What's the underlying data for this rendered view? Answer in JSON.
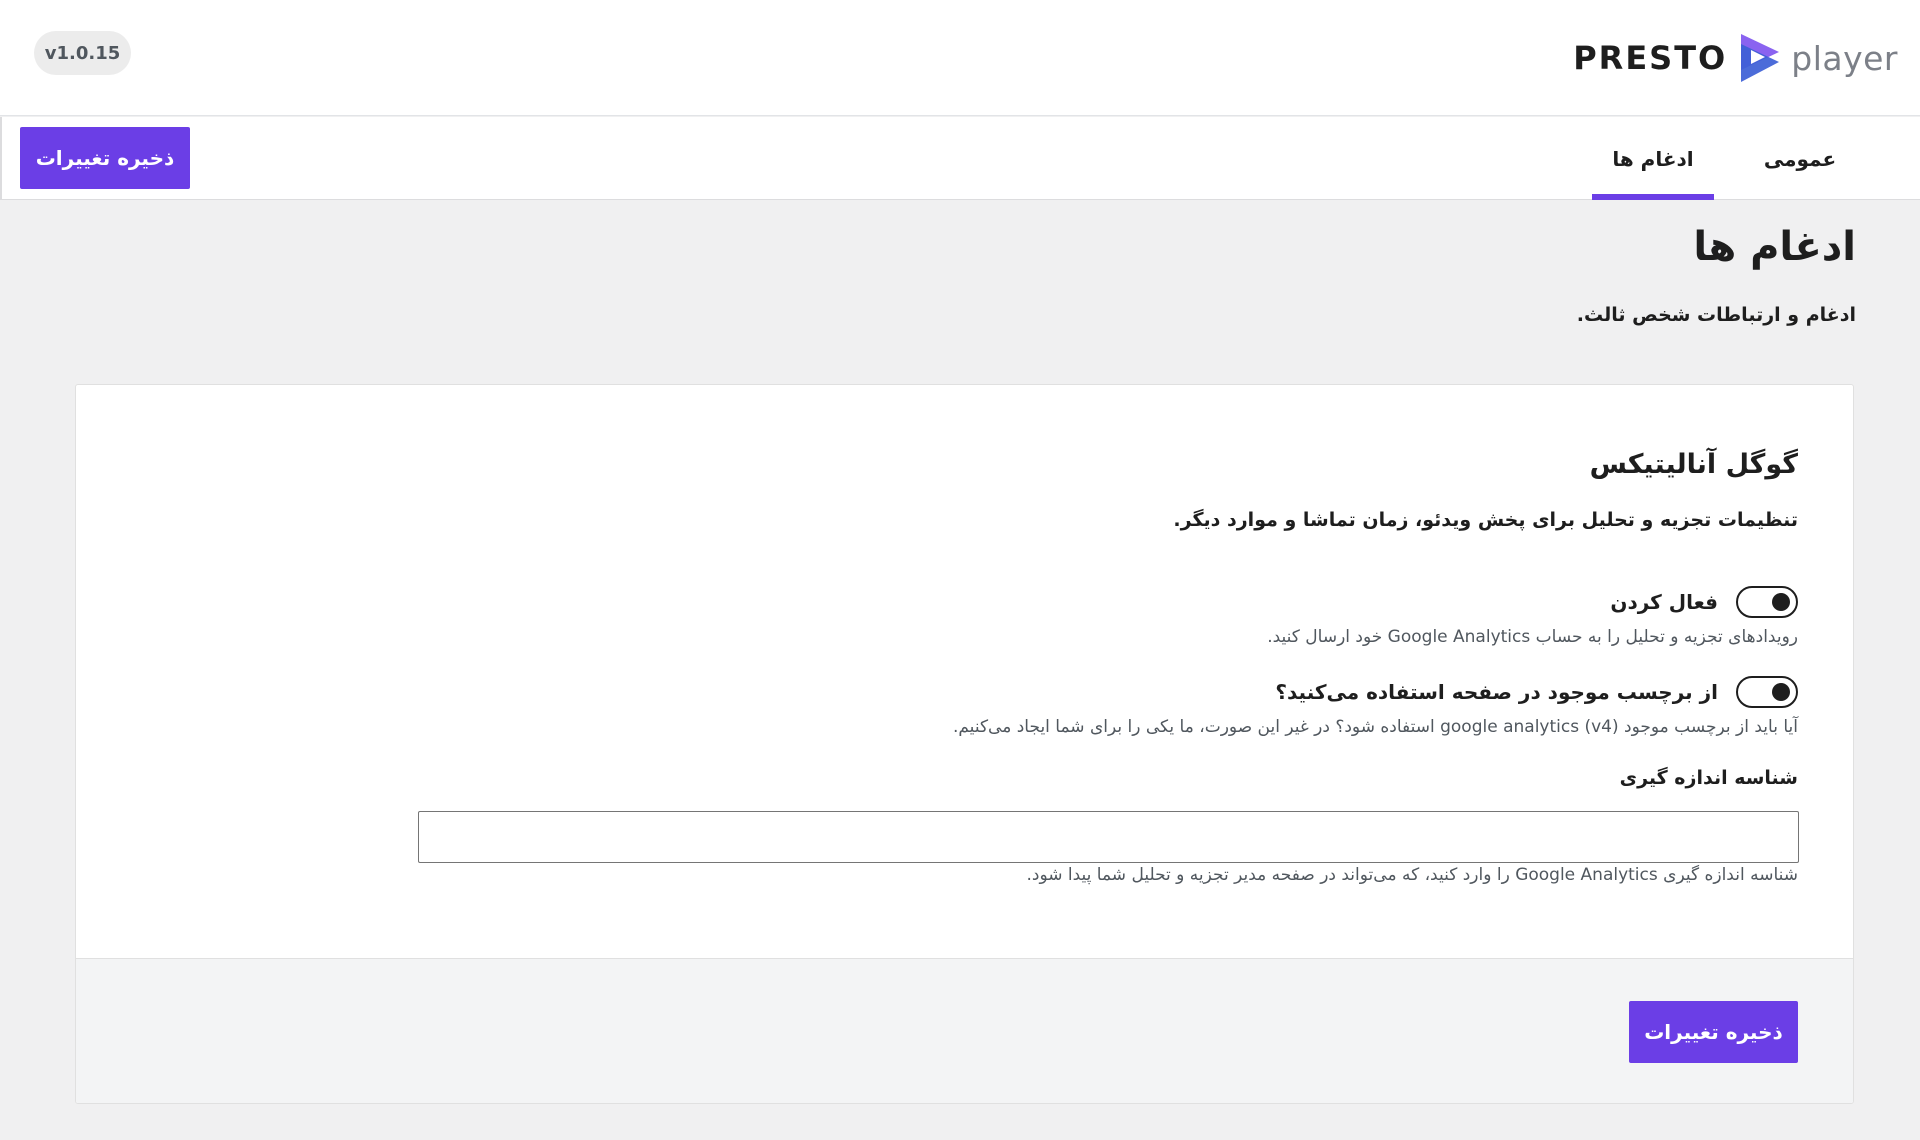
{
  "header": {
    "version": "v1.0.15",
    "logo": {
      "brand_left": "PRESTO",
      "brand_right": "player"
    }
  },
  "toolbar": {
    "save_label": "ذخیره تغییرات",
    "tabs": [
      {
        "label": "عمومی",
        "active": false
      },
      {
        "label": "ادغام ها",
        "active": true
      }
    ]
  },
  "page": {
    "title": "ادغام ها",
    "subtitle": "ادغام و ارتباطات شخص ثالث."
  },
  "google_analytics": {
    "title": "گوگل آنالیتیکس",
    "description": "تنظیمات تجزیه و تحلیل برای پخش ویدئو، زمان تماشا و موارد دیگر.",
    "enable": {
      "label": "فعال کردن",
      "checked": true,
      "help": "رویدادهای تجزیه و تحلیل را به حساب Google Analytics خود ارسال کنید."
    },
    "existing_tag": {
      "label": "از برچسب موجود در صفحه استفاده می‌کنید؟",
      "checked": true,
      "help": "آیا باید از برچسب موجود google analytics (v4) استفاده شود؟ در غیر این صورت، ما یکی را برای شما ایجاد می‌کنیم."
    },
    "measurement_id": {
      "label": "شناسه اندازه گیری",
      "value": "",
      "placeholder": "",
      "help": "شناسه اندازه گیری Google Analytics را وارد کنید، که می‌تواند در صفحه مدیر تجزیه و تحلیل شما پیدا شود."
    },
    "save_label": "ذخیره تغییرات"
  },
  "colors": {
    "accent": "#6b3ee6",
    "background": "#f0f0f1",
    "card": "#ffffff",
    "card_footer": "#f3f4f5",
    "logo_mark_light": "#8a63f0",
    "logo_mark_dark": "#3d5fd6"
  },
  "icons": {
    "logo_mark": "presto-play-logo-icon"
  }
}
